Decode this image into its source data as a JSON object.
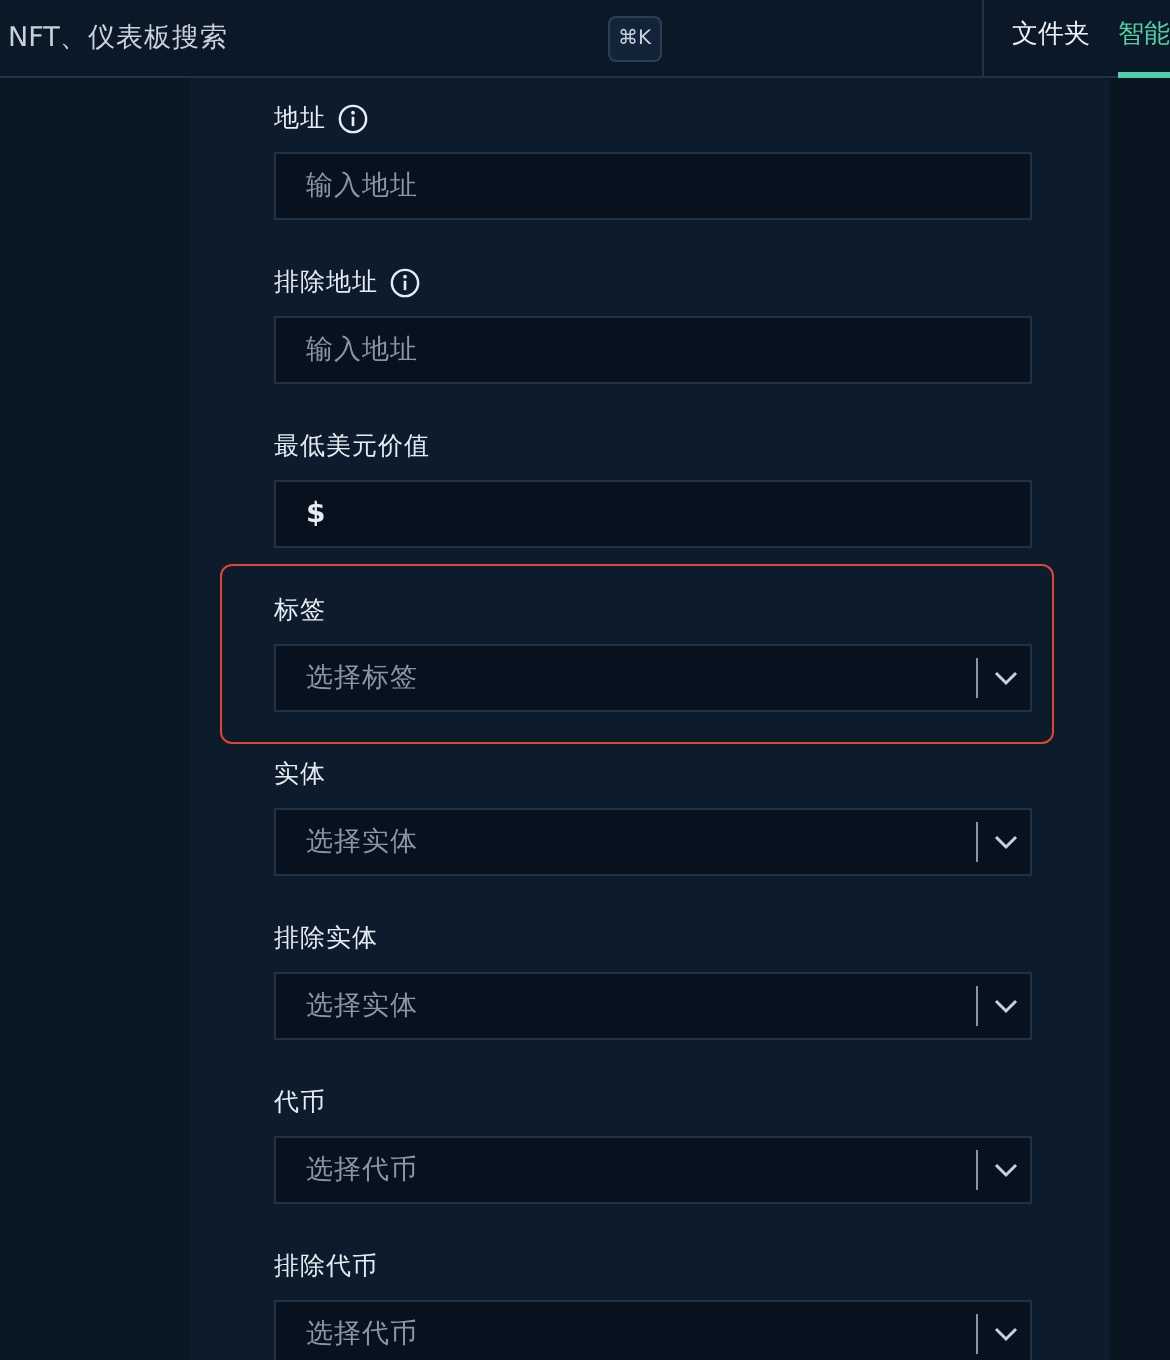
{
  "search": {
    "placeholder": "NFT、仪表板搜索",
    "shortcut": "⌘K"
  },
  "tabs": [
    {
      "label": "文件夹",
      "selected": false
    },
    {
      "label": "智能",
      "selected": true
    }
  ],
  "fields": [
    {
      "label": "地址",
      "info": true,
      "kind": "text",
      "placeholder": "输入地址",
      "highlighted": false
    },
    {
      "label": "排除地址",
      "info": true,
      "kind": "text",
      "placeholder": "输入地址",
      "highlighted": false
    },
    {
      "label": "最低美元价值",
      "info": false,
      "kind": "currency",
      "value": "$",
      "highlighted": false
    },
    {
      "label": "标签",
      "info": false,
      "kind": "select",
      "placeholder": "选择标签",
      "highlighted": true
    },
    {
      "label": "实体",
      "info": false,
      "kind": "select",
      "placeholder": "选择实体",
      "highlighted": false
    },
    {
      "label": "排除实体",
      "info": false,
      "kind": "select",
      "placeholder": "选择实体",
      "highlighted": false
    },
    {
      "label": "代币",
      "info": false,
      "kind": "select",
      "placeholder": "选择代币",
      "highlighted": false
    },
    {
      "label": "排除代币",
      "info": false,
      "kind": "select",
      "placeholder": "选择代币",
      "highlighted": false
    }
  ]
}
